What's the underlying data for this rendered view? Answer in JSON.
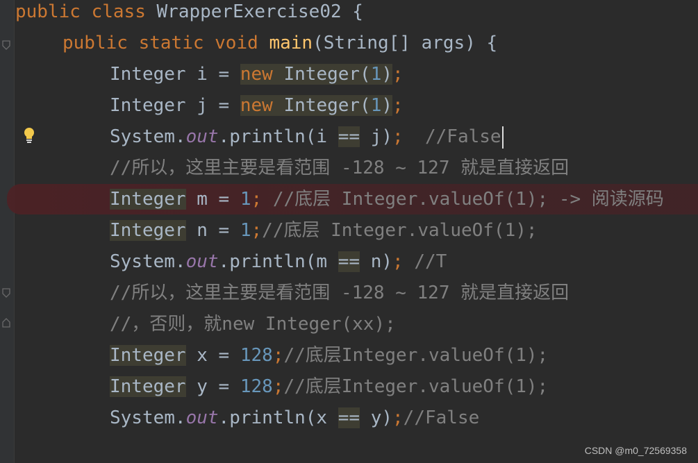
{
  "code": {
    "class_kw1": "public",
    "class_kw2": "class",
    "class_name": " WrapperExercise02 {",
    "main_kw1": "public",
    "main_kw2": "static",
    "main_kw3": "void",
    "main_name": "main",
    "main_args": "(String[] args) {",
    "l3_type": "Integer",
    "l3_var": " i = ",
    "l3_new": "new",
    "l3_ctor": " Integer(",
    "l3_num": "1",
    "l3_close": ")",
    "l3_semi": ";",
    "l4_type": "Integer",
    "l4_var": " j = ",
    "l4_new": "new",
    "l4_ctor": " Integer(",
    "l4_num": "1",
    "l4_close": ")",
    "l4_semi": ";",
    "l5_sys": "System.",
    "l5_out": "out",
    "l5_print": ".println(i ",
    "l5_eq": "==",
    "l5_rest": " j)",
    "l5_semi": ";",
    "l5_comment": "  //False",
    "l6_comment": "//所以，这里主要是看范围 -128 ~ 127 就是直接返回",
    "l7_type": "Integer",
    "l7_var": " m = ",
    "l7_num": "1",
    "l7_semi": ";",
    "l7_comment": " //底层 Integer.valueOf(1); -> 阅读源码",
    "l8_type": "Integer",
    "l8_var": " n = ",
    "l8_num": "1",
    "l8_semi": ";",
    "l8_comment": "//底层 Integer.valueOf(1);",
    "l9_sys": "System.",
    "l9_out": "out",
    "l9_print": ".println(m ",
    "l9_eq": "==",
    "l9_rest": " n)",
    "l9_semi": ";",
    "l9_comment": " //T",
    "l10_comment": "//所以，这里主要是看范围 -128 ~ 127 就是直接返回",
    "l11_comment": "//，否则，就new Integer(xx);",
    "l12_type": "Integer",
    "l12_var": " x = ",
    "l12_num": "128",
    "l12_semi": ";",
    "l12_comment": "//底层Integer.valueOf(1);",
    "l13_type": "Integer",
    "l13_var": " y = ",
    "l13_num": "128",
    "l13_semi": ";",
    "l13_comment": "//底层Integer.valueOf(1);",
    "l14_sys": "System.",
    "l14_out": "out",
    "l14_print": ".println(x ",
    "l14_eq": "==",
    "l14_rest": " y)",
    "l14_semi": ";",
    "l14_comment": "//False"
  },
  "watermark": "CSDN @m0_72569358",
  "icons": {
    "fold": "fold-marker-icon",
    "bulb": "lightbulb-icon"
  },
  "colors": {
    "background": "#2b2b2b",
    "keyword": "#cc7832",
    "function": "#ffc66d",
    "number": "#6897bb",
    "comment": "#808080",
    "static_field": "#9876aa",
    "text": "#a9b7c6"
  }
}
